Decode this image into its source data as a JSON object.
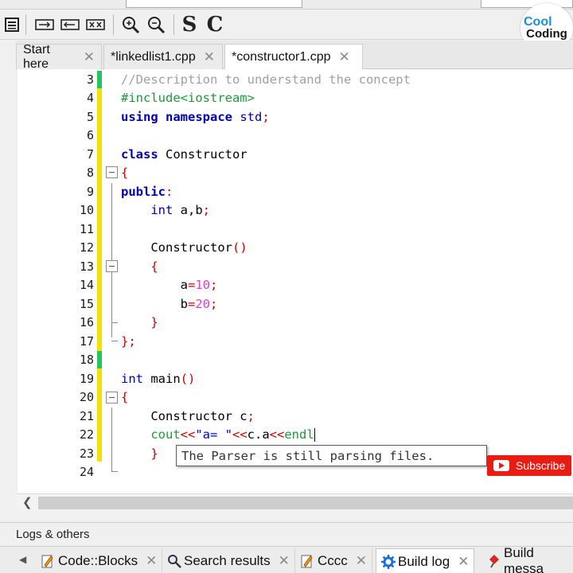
{
  "editor_tabs": [
    {
      "label": "Start here",
      "close": "✕"
    },
    {
      "label": "*linkedlist1.cpp",
      "close": "✕"
    },
    {
      "label": "*constructor1.cpp",
      "close": "✕"
    }
  ],
  "toolbar": {
    "s_label": "S",
    "c_label": "C"
  },
  "logo": {
    "line1": "Cool",
    "line2": "Coding"
  },
  "tooltip": "The Parser is still parsing files.",
  "subscribe": "Subscribe",
  "bottom_panel": {
    "title": "Logs & others",
    "tabs": [
      {
        "label": "Code::Blocks",
        "close": "✕"
      },
      {
        "label": "Search results",
        "close": "✕"
      },
      {
        "label": "Cccc",
        "close": "✕"
      },
      {
        "label": "Build log",
        "close": "✕"
      },
      {
        "label": "Build messa"
      }
    ]
  },
  "code": {
    "line_numbers": [
      "3",
      "4",
      "5",
      "6",
      "7",
      "8",
      "9",
      "10",
      "11",
      "12",
      "13",
      "14",
      "15",
      "16",
      "17",
      "18",
      "19",
      "20",
      "21",
      "22",
      "23",
      "24"
    ],
    "l3": "//Description to understand the concept",
    "l4": "#include<iostream>",
    "l5_kw1": "using",
    "l5_kw2": "namespace",
    "l5_rest": " std",
    "l5_semi": ";",
    "l7_kw": "class",
    "l7_rest": " Constructor",
    "l8": "{",
    "l9_kw": "public",
    "l9_colon": ":",
    "l10_ty": "int",
    "l10_rest": " a,b",
    "l10_semi": ";",
    "l12_name": "Constructor",
    "l12_paren": "()",
    "l13": "{",
    "l14_var": "a",
    "l14_eq": "=",
    "l14_num": "10",
    "l14_semi": ";",
    "l15_var": "b",
    "l15_eq": "=",
    "l15_num": "20",
    "l15_semi": ";",
    "l16": "}",
    "l17": "};",
    "l19_ty": "int",
    "l19_rest": " main",
    "l19_paren": "()",
    "l20": "{",
    "l21_rest": "Constructor c",
    "l21_semi": ";",
    "l22_cout": "cout",
    "l22_op1": "<<",
    "l22_str": "\"a= \"",
    "l22_op2": "<<",
    "l22_mid": "c.a",
    "l22_op3": "<<",
    "l22_endl": "endl",
    "l23": "}"
  }
}
